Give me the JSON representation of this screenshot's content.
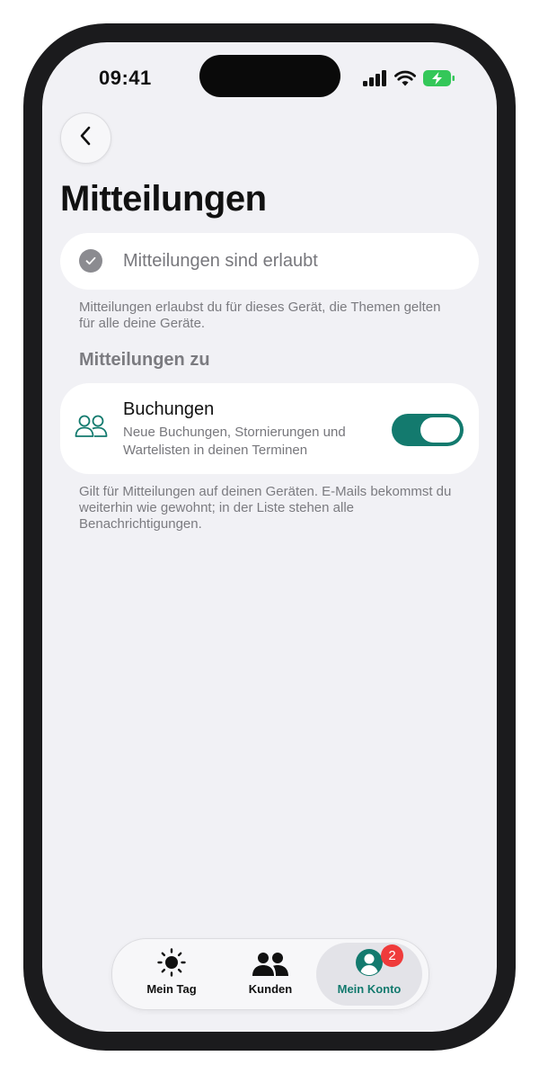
{
  "status_bar": {
    "time": "09:41",
    "signal_icon": "cellular-signal-icon",
    "wifi_icon": "wifi-icon",
    "battery_icon": "battery-charging-icon",
    "battery_color": "#34c759"
  },
  "header": {
    "back_icon": "chevron-left-icon",
    "title": "Mitteilungen"
  },
  "permission": {
    "icon": "checkmark-circle-icon",
    "text": "Mitteilungen sind erlaubt",
    "note": "Mitteilungen erlaubst du für dieses Gerät, die Themen gelten für alle deine Geräte."
  },
  "section": {
    "heading": "Mitteilungen zu"
  },
  "bookings": {
    "icon": "people-icon",
    "title": "Buchungen",
    "subtitle": "Neue Buchungen, Stornierungen und Wartelisten in deinen Terminen",
    "toggle_on": true,
    "note": "Gilt für Mitteilungen auf deinen Geräten. E-Mails bekommst du weiterhin wie gewohnt; in der Liste stehen alle Benachrichtigungen."
  },
  "tabbar": {
    "tabs": [
      {
        "label": "Mein Tag",
        "icon": "sun-icon",
        "active": false
      },
      {
        "label": "Kunden",
        "icon": "people-icon",
        "active": false
      },
      {
        "label": "Mein Konto",
        "icon": "account-icon",
        "active": true,
        "badge": "2"
      }
    ]
  },
  "colors": {
    "accent": "#137a6e",
    "badge": "#ef3b3b",
    "background": "#f1f1f5"
  }
}
